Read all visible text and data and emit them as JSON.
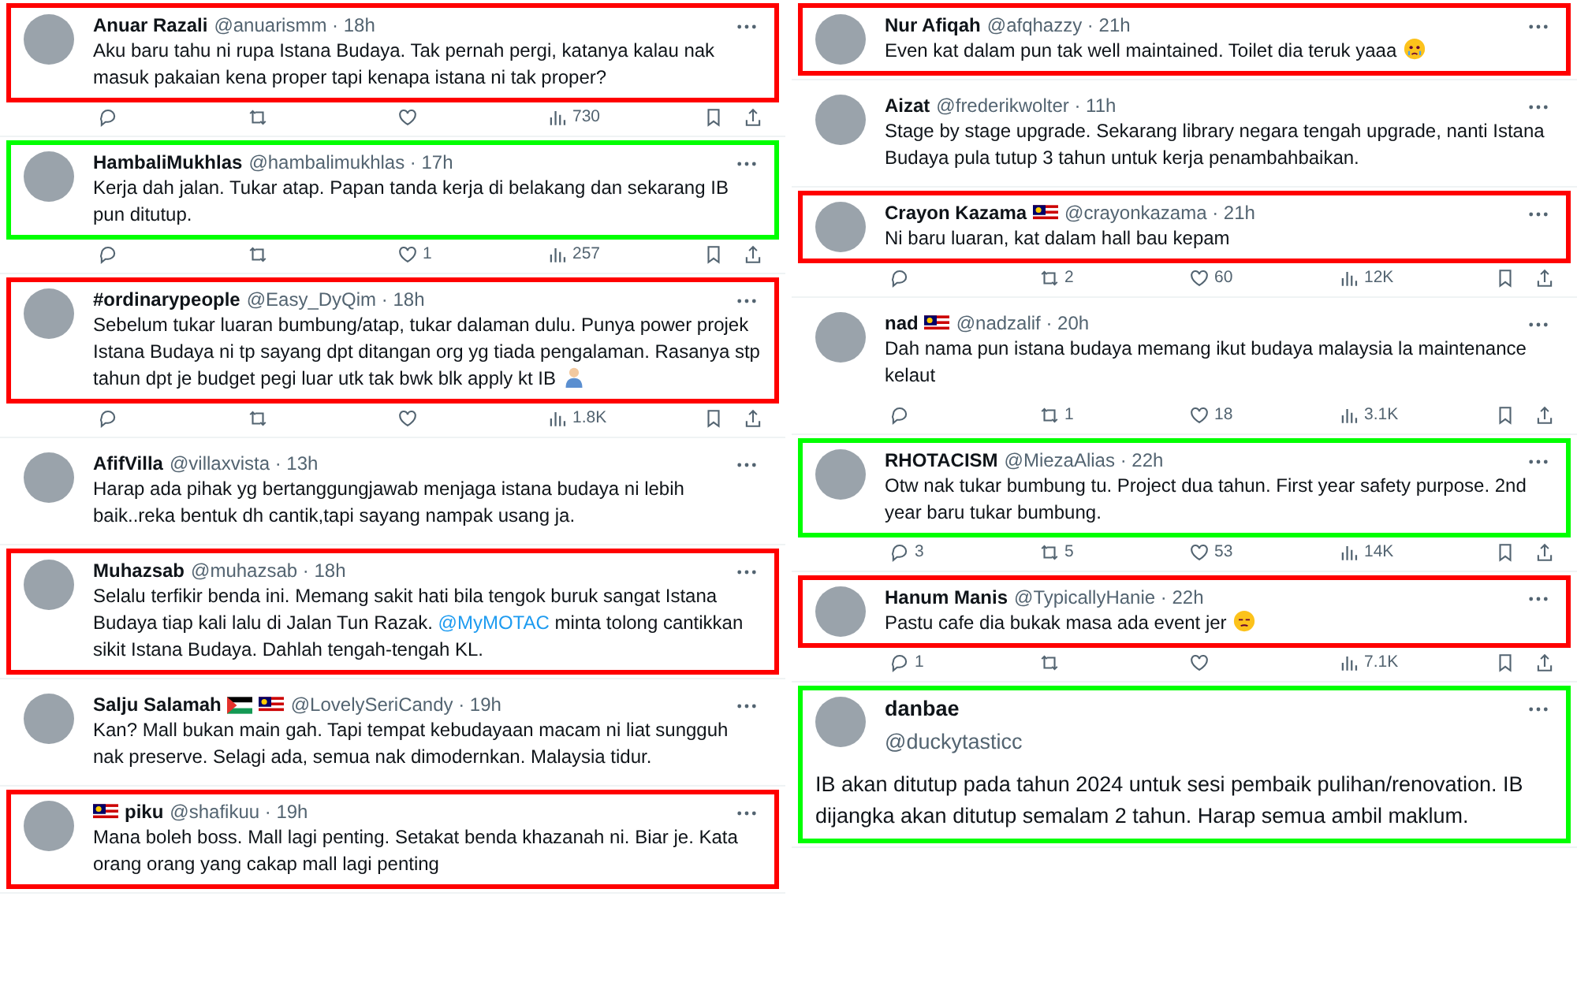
{
  "columns": [
    {
      "tweets": [
        {
          "kind": "reply",
          "name": "Anuar Razali",
          "meta": "@anuarismm · 18h",
          "color": "#ff0000",
          "segments": [
            {
              "kind": "plain",
              "text": "Aku baru tahu ni rupa Istana Budaya. Tak pernah pergi, katanya kalau nak masuk pakaian kena proper tapi kenapa istana ni tak proper?"
            }
          ],
          "actions": {
            "views": "730"
          }
        },
        {
          "kind": "reply",
          "name": "HambaliMukhlas",
          "meta": "@hambalimukhlas · 17h",
          "color": "#00ff00",
          "segments": [
            {
              "kind": "plain",
              "text": "Kerja dah jalan. Tukar atap. Papan tanda kerja di belakang dan sekarang IB pun ditutup."
            }
          ],
          "actions": {
            "likes": "1",
            "views": "257"
          }
        },
        {
          "kind": "reply",
          "name": "#ordinarypeople",
          "meta": "@Easy_DyQim · 18h",
          "color": "#ff0000",
          "segments": [
            {
              "kind": "plain",
              "text": "Sebelum tukar luaran bumbung/atap, tukar dalaman dulu. Punya power projek Istana Budaya ni tp sayang dpt ditangan org yg tiada pengalaman. Rasanya stp tahun dpt je budget pegi luar utk tak bwk blk apply kt IB"
            }
          ],
          "emoji": {
            "kind": "person"
          },
          "actions": {
            "views": "1.8K"
          }
        },
        {
          "kind": "reply",
          "name": "AfifVilla",
          "meta": "@villaxvista · 13h",
          "segments": [
            {
              "kind": "plain",
              "text": "Harap ada pihak yg bertanggungjawab menjaga istana budaya ni lebih baik..reka bentuk dh cantik,tapi sayang nampak usang ja."
            }
          ]
        },
        {
          "kind": "reply",
          "name": "Muhazsab",
          "meta": "@muhazsab · 18h",
          "color": "#ff0000",
          "segments": [
            {
              "kind": "plain",
              "text": "Selalu terfikir benda ini. Memang sakit hati bila tengok buruk sangat Istana Budaya tiap kali lalu di Jalan Tun Razak. "
            },
            {
              "kind": "mention",
              "text": "@MyMOTAC"
            },
            {
              "kind": "plain",
              "text": " minta tolong cantikkan sikit Istana Budaya. Dahlah tengah-tengah KL."
            }
          ]
        },
        {
          "kind": "reply",
          "name": "Salju Salamah",
          "flags_after": [
            {
              "kind": "palestine"
            },
            {
              "kind": "malaysia"
            }
          ],
          "meta": "@LovelySeriCandy · 19h",
          "segments": [
            {
              "kind": "plain",
              "text": "Kan? Mall bukan main gah. Tapi tempat kebudayaan macam ni liat sungguh nak preserve. Selagi ada, semua nak dimodernkan. Malaysia tidur."
            }
          ]
        },
        {
          "kind": "reply",
          "name": "piku",
          "flags_before": [
            {
              "kind": "malaysia"
            }
          ],
          "meta": "@shafikuu · 19h",
          "color": "#ff0000",
          "segments": [
            {
              "kind": "plain",
              "text": "Mana boleh boss. Mall lagi penting. Setakat benda khazanah ni. Biar je. Kata orang orang yang cakap mall lagi penting"
            }
          ]
        }
      ]
    },
    {
      "tweets": [
        {
          "kind": "reply",
          "name": "Nur Afiqah",
          "meta": "@afqhazzy · 21h",
          "color": "#ff0000",
          "segments": [
            {
              "kind": "plain",
              "text": "Even kat dalam pun tak well maintained. Toilet dia teruk yaaa"
            }
          ],
          "emoji": {
            "kind": "teary"
          }
        },
        {
          "kind": "reply",
          "name": "Aizat",
          "meta": "@frederikwolter · 11h",
          "segments": [
            {
              "kind": "plain",
              "text": "Stage by stage upgrade. Sekarang library negara tengah upgrade, nanti Istana Budaya pula tutup 3 tahun untuk kerja penambahbaikan."
            }
          ]
        },
        {
          "kind": "reply",
          "name": "Crayon Kazama",
          "flags_after": [
            {
              "kind": "malaysia"
            }
          ],
          "meta": "@crayonkazama · 21h",
          "color": "#ff0000",
          "segments": [
            {
              "kind": "plain",
              "text": "Ni baru luaran, kat dalam hall bau kepam"
            }
          ],
          "actions": {
            "retweets": "2",
            "likes": "60",
            "views": "12K"
          }
        },
        {
          "kind": "reply",
          "name": "nad",
          "flags_after": [
            {
              "kind": "malaysia"
            }
          ],
          "meta": "@nadzalif · 20h",
          "segments": [
            {
              "kind": "plain",
              "text": "Dah nama pun istana budaya memang ikut budaya malaysia la maintenance kelaut"
            }
          ],
          "actions": {
            "retweets": "1",
            "likes": "18",
            "views": "3.1K"
          }
        },
        {
          "kind": "reply",
          "name": "RHOTACISM",
          "meta": "@MiezaAlias · 22h",
          "color": "#00ff00",
          "segments": [
            {
              "kind": "plain",
              "text": "Otw nak tukar bumbung tu. Project dua tahun. First year safety purpose. 2nd year baru tukar bumbung."
            }
          ],
          "actions": {
            "replies": "3",
            "retweets": "5",
            "likes": "53",
            "views": "14K"
          }
        },
        {
          "kind": "reply",
          "name": "Hanum Manis",
          "meta": "@TypicallyHanie · 22h",
          "color": "#ff0000",
          "segments": [
            {
              "kind": "plain",
              "text": "Pastu cafe dia bukak masa ada event jer"
            }
          ],
          "emoji": {
            "kind": "sleepy"
          },
          "actions": {
            "replies": "1",
            "views": "7.1K"
          }
        },
        {
          "kind": "expanded",
          "name": "danbae",
          "meta": "@duckytasticc",
          "color": "#00ff00",
          "segments": [
            {
              "kind": "plain",
              "text": "IB akan ditutup pada tahun 2024 untuk sesi pembaik pulihan/renovation. IB dijangka akan ditutup semalam 2 tahun. Harap semua ambil maklum."
            }
          ]
        }
      ]
    }
  ]
}
